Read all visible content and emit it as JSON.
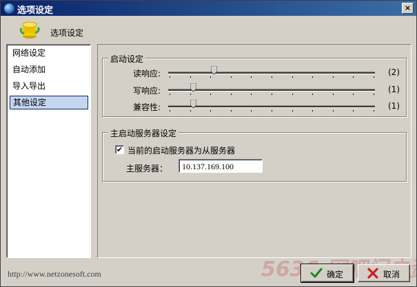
{
  "window": {
    "title": "选项设定",
    "close_label": "×"
  },
  "header": {
    "title": "选项设定"
  },
  "sidebar": {
    "items": [
      {
        "label": "网络设定",
        "selected": false
      },
      {
        "label": "自动添加",
        "selected": false
      },
      {
        "label": "导入导出",
        "selected": false
      },
      {
        "label": "其他设定",
        "selected": true
      }
    ]
  },
  "startup": {
    "legend": "启动设定",
    "sliders": [
      {
        "label": "读响应:",
        "value_text": "(2)",
        "value": 2
      },
      {
        "label": "写响应:",
        "value_text": "(1)",
        "value": 1
      },
      {
        "label": "兼容性:",
        "value_text": "(1)",
        "value": 1
      }
    ]
  },
  "master": {
    "legend": "主启动服务器设定",
    "checkbox_label": "当前的启动服务器为从服务器",
    "checked": true,
    "server_label": "主服务器：",
    "server_value": "10.137.169.100"
  },
  "footer": {
    "url": "http://www.netzonesoft.com",
    "ok_label": "确定",
    "cancel_label": "取消"
  },
  "watermark": "5636 网吧门户资讯",
  "colors": {
    "title_bar": "#0a246a",
    "selection": "#c5d5ee",
    "ok_check": "#1a8a1a",
    "cancel_x": "#cc2020"
  }
}
